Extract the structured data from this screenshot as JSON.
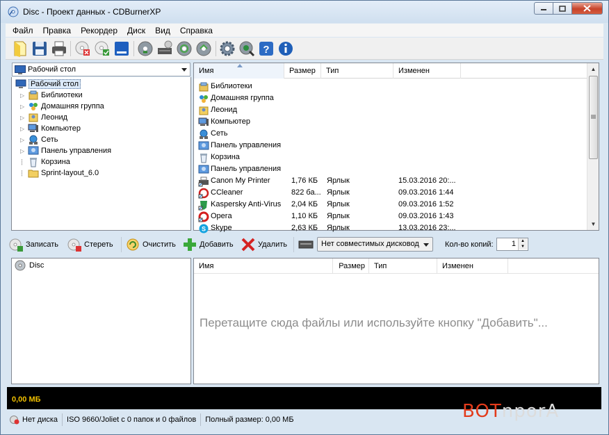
{
  "window": {
    "title": "Disc - Проект данных - CDBurnerXP"
  },
  "menu": [
    "Файл",
    "Правка",
    "Рекордер",
    "Диск",
    "Вид",
    "Справка"
  ],
  "toolbar_icons": [
    "new-project-icon",
    "save-icon",
    "print-icon",
    "erase-disc-icon",
    "disc-ok-icon",
    "blue-square-icon",
    "disc-copy-icon",
    "burn-drive-icon",
    "disc-green-icon",
    "disc-green2-icon",
    "settings-icon",
    "search-disc-icon",
    "help-icon",
    "info-icon"
  ],
  "location": {
    "selected": "Рабочий стол"
  },
  "tree": [
    {
      "label": "Рабочий стол",
      "icon": "desktop-icon",
      "level": 0,
      "expander": false,
      "selected": true
    },
    {
      "label": "Библиотеки",
      "icon": "libraries-icon",
      "level": 1,
      "expander": true
    },
    {
      "label": "Домашняя группа",
      "icon": "homegroup-icon",
      "level": 1,
      "expander": true
    },
    {
      "label": "Леонид",
      "icon": "user-folder-icon",
      "level": 1,
      "expander": true
    },
    {
      "label": "Компьютер",
      "icon": "computer-icon",
      "level": 1,
      "expander": true
    },
    {
      "label": "Сеть",
      "icon": "network-icon",
      "level": 1,
      "expander": true
    },
    {
      "label": "Панель управления",
      "icon": "control-panel-icon",
      "level": 1,
      "expander": true
    },
    {
      "label": "Корзина",
      "icon": "recycle-bin-icon",
      "level": 1,
      "expander": false
    },
    {
      "label": "Sprint-layout_6.0",
      "icon": "folder-icon",
      "level": 1,
      "expander": false
    }
  ],
  "filelist": {
    "columns": [
      "Имя",
      "Размер",
      "Тип",
      "Изменен"
    ],
    "rows": [
      {
        "name": "Библиотеки",
        "size": "",
        "type": "",
        "modified": "",
        "icon": "libraries-icon"
      },
      {
        "name": "Домашняя группа",
        "size": "",
        "type": "",
        "modified": "",
        "icon": "homegroup-icon"
      },
      {
        "name": "Леонид",
        "size": "",
        "type": "",
        "modified": "",
        "icon": "user-folder-icon"
      },
      {
        "name": "Компьютер",
        "size": "",
        "type": "",
        "modified": "",
        "icon": "computer-icon"
      },
      {
        "name": "Сеть",
        "size": "",
        "type": "",
        "modified": "",
        "icon": "network-icon"
      },
      {
        "name": "Панель управления",
        "size": "",
        "type": "",
        "modified": "",
        "icon": "control-panel-icon"
      },
      {
        "name": "Корзина",
        "size": "",
        "type": "",
        "modified": "",
        "icon": "recycle-bin-icon"
      },
      {
        "name": "Панель управления",
        "size": "",
        "type": "",
        "modified": "",
        "icon": "control-panel-icon"
      },
      {
        "name": "Canon My Printer",
        "size": "1,76 КБ",
        "type": "Ярлык",
        "modified": "15.03.2016 20:...",
        "icon": "printer-shortcut-icon"
      },
      {
        "name": "CCleaner",
        "size": "822 ба...",
        "type": "Ярлык",
        "modified": "09.03.2016 1:44",
        "icon": "ccleaner-icon"
      },
      {
        "name": "Kaspersky Anti-Virus",
        "size": "2,04 КБ",
        "type": "Ярлык",
        "modified": "09.03.2016 1:52",
        "icon": "kaspersky-icon"
      },
      {
        "name": "Opera",
        "size": "1,10 КБ",
        "type": "Ярлык",
        "modified": "09.03.2016 1:43",
        "icon": "opera-icon"
      },
      {
        "name": "Skype",
        "size": "2,63 КБ",
        "type": "Ярлык",
        "modified": "13.03.2016 23:...",
        "icon": "skype-icon"
      }
    ]
  },
  "actions": {
    "burn": "Записать",
    "erase": "Стереть",
    "clear": "Очистить",
    "add": "Добавить",
    "remove": "Удалить",
    "drive": "Нет совместимых дисковод",
    "copies_label": "Кол-во копий:",
    "copies_value": "1"
  },
  "disc_tree": {
    "label": "Disc"
  },
  "compilation": {
    "columns": [
      "Имя",
      "Размер",
      "Тип",
      "Изменен"
    ],
    "hint": "Перетащите сюда файлы или используйте кнопку \"Добавить\"..."
  },
  "capacity": {
    "used": "0,00 МБ"
  },
  "watermark": {
    "part1": "BOT",
    "part2": "nporA"
  },
  "status": {
    "disc": "Нет диска",
    "fs": "ISO 9660/Joliet с 0 папок и 0 файлов",
    "total": "Полный размер: 0,00 МБ"
  },
  "colors": {
    "accent": "#3a6ea5",
    "capacity_text": "#f0c000",
    "watermark_red": "#e33b1b"
  }
}
